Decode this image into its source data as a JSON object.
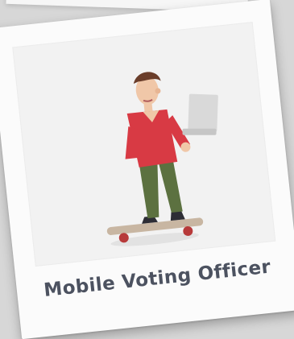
{
  "card": {
    "caption": "Mobile Voting Officer"
  },
  "illustration": {
    "icon_name": "person-on-skateboard-with-laptop-illustration",
    "colors": {
      "shirt": "#d83a44",
      "pants": "#5c7140",
      "hair": "#6a3d2a",
      "skin": "#f0c7a8",
      "laptop": "#d9d9d9",
      "skateboard_deck": "#c8b6a2",
      "wheels": "#b73a3a"
    }
  }
}
